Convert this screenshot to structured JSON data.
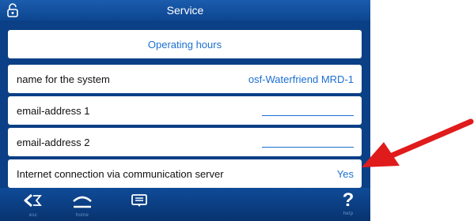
{
  "window": {
    "title": "Service"
  },
  "rows": {
    "operating_hours": {
      "label": "Operating hours"
    },
    "system_name": {
      "label": "name for the system",
      "value": "osf-Waterfriend MRD-1"
    },
    "email_1": {
      "label": "email-address 1",
      "value": ""
    },
    "email_2": {
      "label": "email-address 2",
      "value": ""
    },
    "internet": {
      "label": "Internet connection via communication server",
      "value": "Yes"
    }
  },
  "bottom_nav": {
    "esc": {
      "label": "esc",
      "icon": "back-icon"
    },
    "home": {
      "label": "home",
      "icon": "home-icon"
    },
    "menu": {
      "label": "",
      "icon": "menu-icon"
    },
    "help": {
      "label": "help",
      "symbol": "?",
      "icon": "help-icon"
    }
  },
  "colors": {
    "frame": "#0b3f86",
    "accent_text": "#1d6fd1",
    "arrow": "#e01b1b"
  },
  "icons": {
    "top_left": "lock-open-icon",
    "annotation": "red-arrow-icon"
  }
}
